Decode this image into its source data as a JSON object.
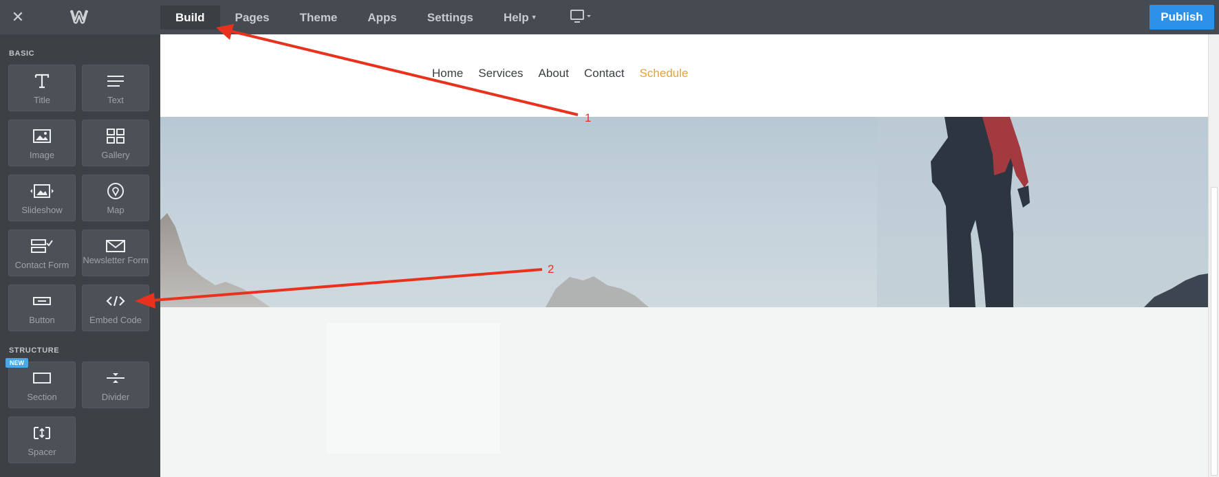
{
  "topbar": {
    "close_icon": "close-icon",
    "logo_icon": "weebly-logo-icon",
    "nav": [
      {
        "label": "Build",
        "active": true
      },
      {
        "label": "Pages"
      },
      {
        "label": "Theme"
      },
      {
        "label": "Apps"
      },
      {
        "label": "Settings"
      },
      {
        "label": "Help",
        "dropdown": true
      }
    ],
    "device_icon": "desktop-monitor-icon",
    "publish_label": "Publish",
    "publish_color": "#2c91e8"
  },
  "sidebar": {
    "basic_label": "BASIC",
    "structure_label": "STRUCTURE",
    "new_badge": "NEW",
    "basic_tiles": [
      {
        "label": "Title",
        "icon": "title-icon"
      },
      {
        "label": "Text",
        "icon": "text-lines-icon"
      },
      {
        "label": "Image",
        "icon": "image-icon"
      },
      {
        "label": "Gallery",
        "icon": "gallery-grid-icon"
      },
      {
        "label": "Slideshow",
        "icon": "slideshow-icon"
      },
      {
        "label": "Map",
        "icon": "map-pin-icon"
      },
      {
        "label": "Contact Form",
        "icon": "contact-form-icon"
      },
      {
        "label": "Newsletter Form",
        "icon": "envelope-icon"
      },
      {
        "label": "Button",
        "icon": "button-icon"
      },
      {
        "label": "Embed Code",
        "icon": "code-icon"
      }
    ],
    "structure_tiles": [
      {
        "label": "Section",
        "icon": "section-icon"
      },
      {
        "label": "Divider",
        "icon": "divider-icon"
      },
      {
        "label": "Spacer",
        "icon": "spacer-icon"
      }
    ]
  },
  "site": {
    "nav": [
      {
        "label": "Home"
      },
      {
        "label": "Services"
      },
      {
        "label": "About"
      },
      {
        "label": "Contact"
      },
      {
        "label": "Schedule",
        "highlight": true
      }
    ],
    "highlight_color": "#e3a334"
  },
  "annotations": {
    "label_1": "1",
    "label_2": "2",
    "arrow_color": "#e8321e"
  }
}
